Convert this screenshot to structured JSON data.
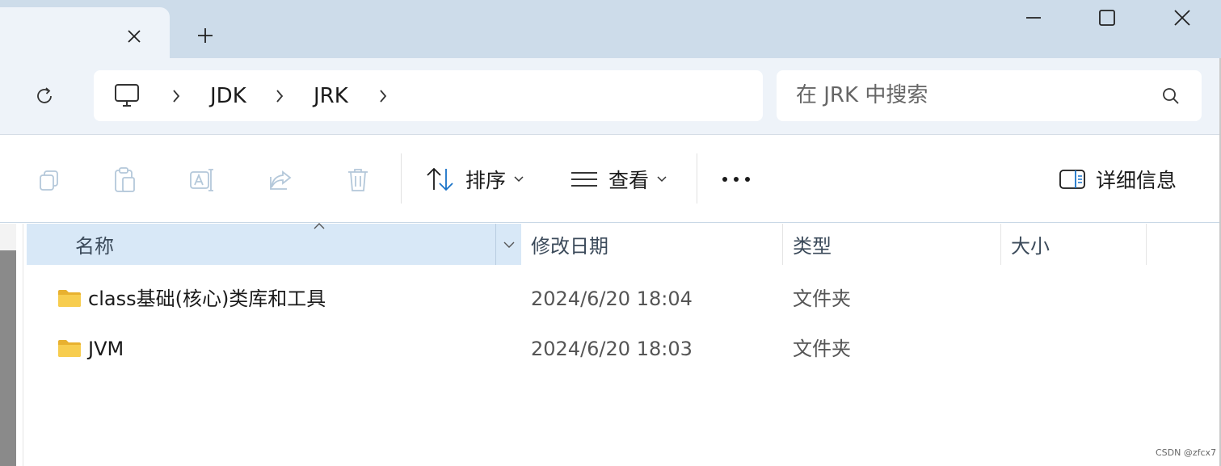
{
  "titlebar": {
    "new_tab_symbol": "+",
    "icons": {
      "close_tab": "close-icon",
      "minimize": "minimize-icon",
      "maximize": "maximize-icon",
      "close_window": "close-icon"
    }
  },
  "navigation": {
    "breadcrumb": [
      "JDK",
      "JRK"
    ],
    "search_placeholder": "在 JRK 中搜索",
    "icons": {
      "refresh": "refresh-icon",
      "root": "this-pc-icon",
      "separator": "chevron-right-icon",
      "search": "search-icon"
    }
  },
  "toolbar": {
    "sort_label": "排序",
    "view_label": "查看",
    "details_label": "详细信息",
    "more_symbol": "•••",
    "icons": [
      "copy-icon",
      "paste-icon",
      "rename-icon",
      "share-icon",
      "delete-icon"
    ]
  },
  "table": {
    "columns": [
      "名称",
      "修改日期",
      "类型",
      "大小"
    ],
    "sorted_column": "名称",
    "rows": [
      {
        "name": "class基础(核心)类库和工具",
        "modified": "2024/6/20 18:04",
        "type": "文件夹",
        "size": ""
      },
      {
        "name": "JVM",
        "modified": "2024/6/20 18:03",
        "type": "文件夹",
        "size": ""
      }
    ]
  },
  "watermark": "CSDN @zfcx7",
  "colors": {
    "tab_bar": "#cddcea",
    "nav_bg": "#eef3f9",
    "accent": "#1a73c8",
    "selected_header": "#d8e8f7",
    "folder": "#f5c542"
  }
}
